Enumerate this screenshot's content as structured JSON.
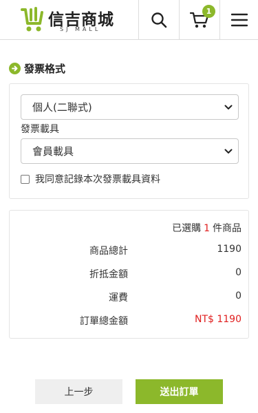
{
  "brand": {
    "name": "信吉商城",
    "sub": "SJ MALL",
    "color": "#8cb82b"
  },
  "header": {
    "cart_count": "1",
    "icons": [
      "search-icon",
      "cart-icon",
      "hamburger-menu-icon"
    ]
  },
  "invoice": {
    "section_title": "發票格式",
    "format_selected": "個人(二聯式)",
    "carrier_label": "發票載具",
    "carrier_selected": "會員載具",
    "agree_text": "我同意記錄本次發票載具資料",
    "agree_checked": false
  },
  "summary": {
    "selected_prefix": "已選購",
    "selected_count": "1",
    "selected_suffix": "件商品",
    "rows": [
      {
        "label": "商品總計",
        "value": "1190"
      },
      {
        "label": "折抵金額",
        "value": "0"
      },
      {
        "label": "運費",
        "value": "0"
      },
      {
        "label": "訂單總金額",
        "value": "NT$ 1190"
      }
    ],
    "total_color": "#e01e1e"
  },
  "actions": {
    "prev_label": "上一步",
    "submit_label": "送出訂單"
  }
}
